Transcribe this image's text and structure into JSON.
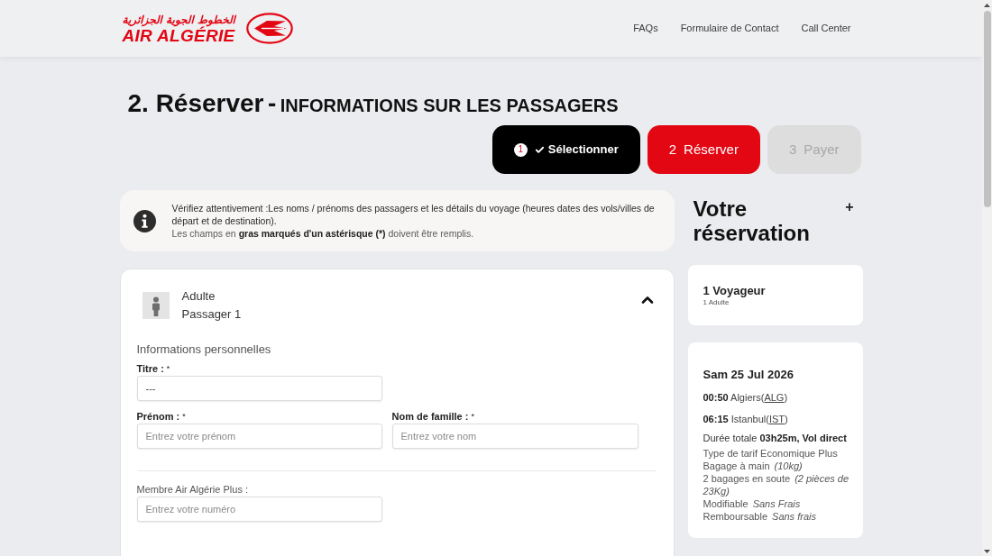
{
  "header": {
    "logo": {
      "arabic": "الخطوط الجوية الجزائرية",
      "latin": "AIR ALGÉRIE"
    },
    "nav": [
      "FAQs",
      "Formulaire de Contact",
      "Call Center"
    ]
  },
  "page_title": {
    "step": "2. Réserver",
    "separator": "-",
    "subtitle": "INFORMATIONS SUR LES PASSAGERS"
  },
  "steps": [
    {
      "number": "1",
      "label": "Sélectionner",
      "completed": true,
      "selected": false
    },
    {
      "number": "2",
      "label": "Réserver",
      "completed": false,
      "selected": true
    },
    {
      "number": "3",
      "label": "Payer",
      "completed": false,
      "selected": false
    }
  ],
  "notice": {
    "paragraphs": [
      [
        {
          "text": "Vérifiez attentivement :Les noms / prénoms des passagers et les détails du voyage (heures dates des vols/villes de départ et de destination).",
          "bold": false
        }
      ],
      [
        {
          "text": "Les champs en",
          "bold": false
        },
        {
          "text": "gras marqués d'un astérisque (*)",
          "bold": true
        },
        {
          "text": "doivent être remplis.",
          "bold": false
        }
      ]
    ]
  },
  "passengers": [
    {
      "type": "Adulte",
      "label": "Passager 1",
      "expanded": true,
      "sections": [
        {
          "title": "Informations personnelles",
          "rows": [
            [
              {
                "label": "Titre :",
                "mark": "*",
                "required": true,
                "kind": "select",
                "value": "---"
              }
            ],
            [
              {
                "label": "Prénom :",
                "mark": "*",
                "required": true,
                "kind": "text",
                "placeholder": "Entrez votre prénom"
              },
              {
                "label": "Nom de famille :",
                "mark": "*",
                "required": true,
                "kind": "text",
                "placeholder": "Entrez votre nom"
              }
            ]
          ]
        },
        {
          "rows": [
            [
              {
                "label": "Membre Air Algérie Plus :",
                "required": false,
                "kind": "text",
                "placeholder": "Entrez votre numéro"
              }
            ]
          ]
        }
      ]
    }
  ],
  "booking_summary": {
    "title": "Votre réservation",
    "toggle": "+",
    "travellers": {
      "count": "1 Voyageur",
      "detail": "1 Adulte"
    },
    "flight": {
      "date": "Sam 25 Jul 2026",
      "stops": [
        {
          "time": "00:50",
          "city": "Algiers(",
          "code": "ALG",
          "close": ")"
        },
        {
          "time": "06:15",
          "city": "Istanbul(",
          "code": "IST",
          "close": ")"
        }
      ],
      "duration": {
        "label": "Durée totale",
        "value": "03h25m, Vol direct"
      },
      "details": [
        {
          "label": "Type de tarif Economique Plus"
        },
        {
          "label": "Bagage à main",
          "note": "(10kg)"
        },
        {
          "label": "2 bagages en soute",
          "note": "(2 pièces de 23Kg)"
        },
        {
          "label": "Modifiable",
          "note": "Sans Frais"
        },
        {
          "label": "Remboursable",
          "note": "Sans frais"
        }
      ]
    }
  }
}
